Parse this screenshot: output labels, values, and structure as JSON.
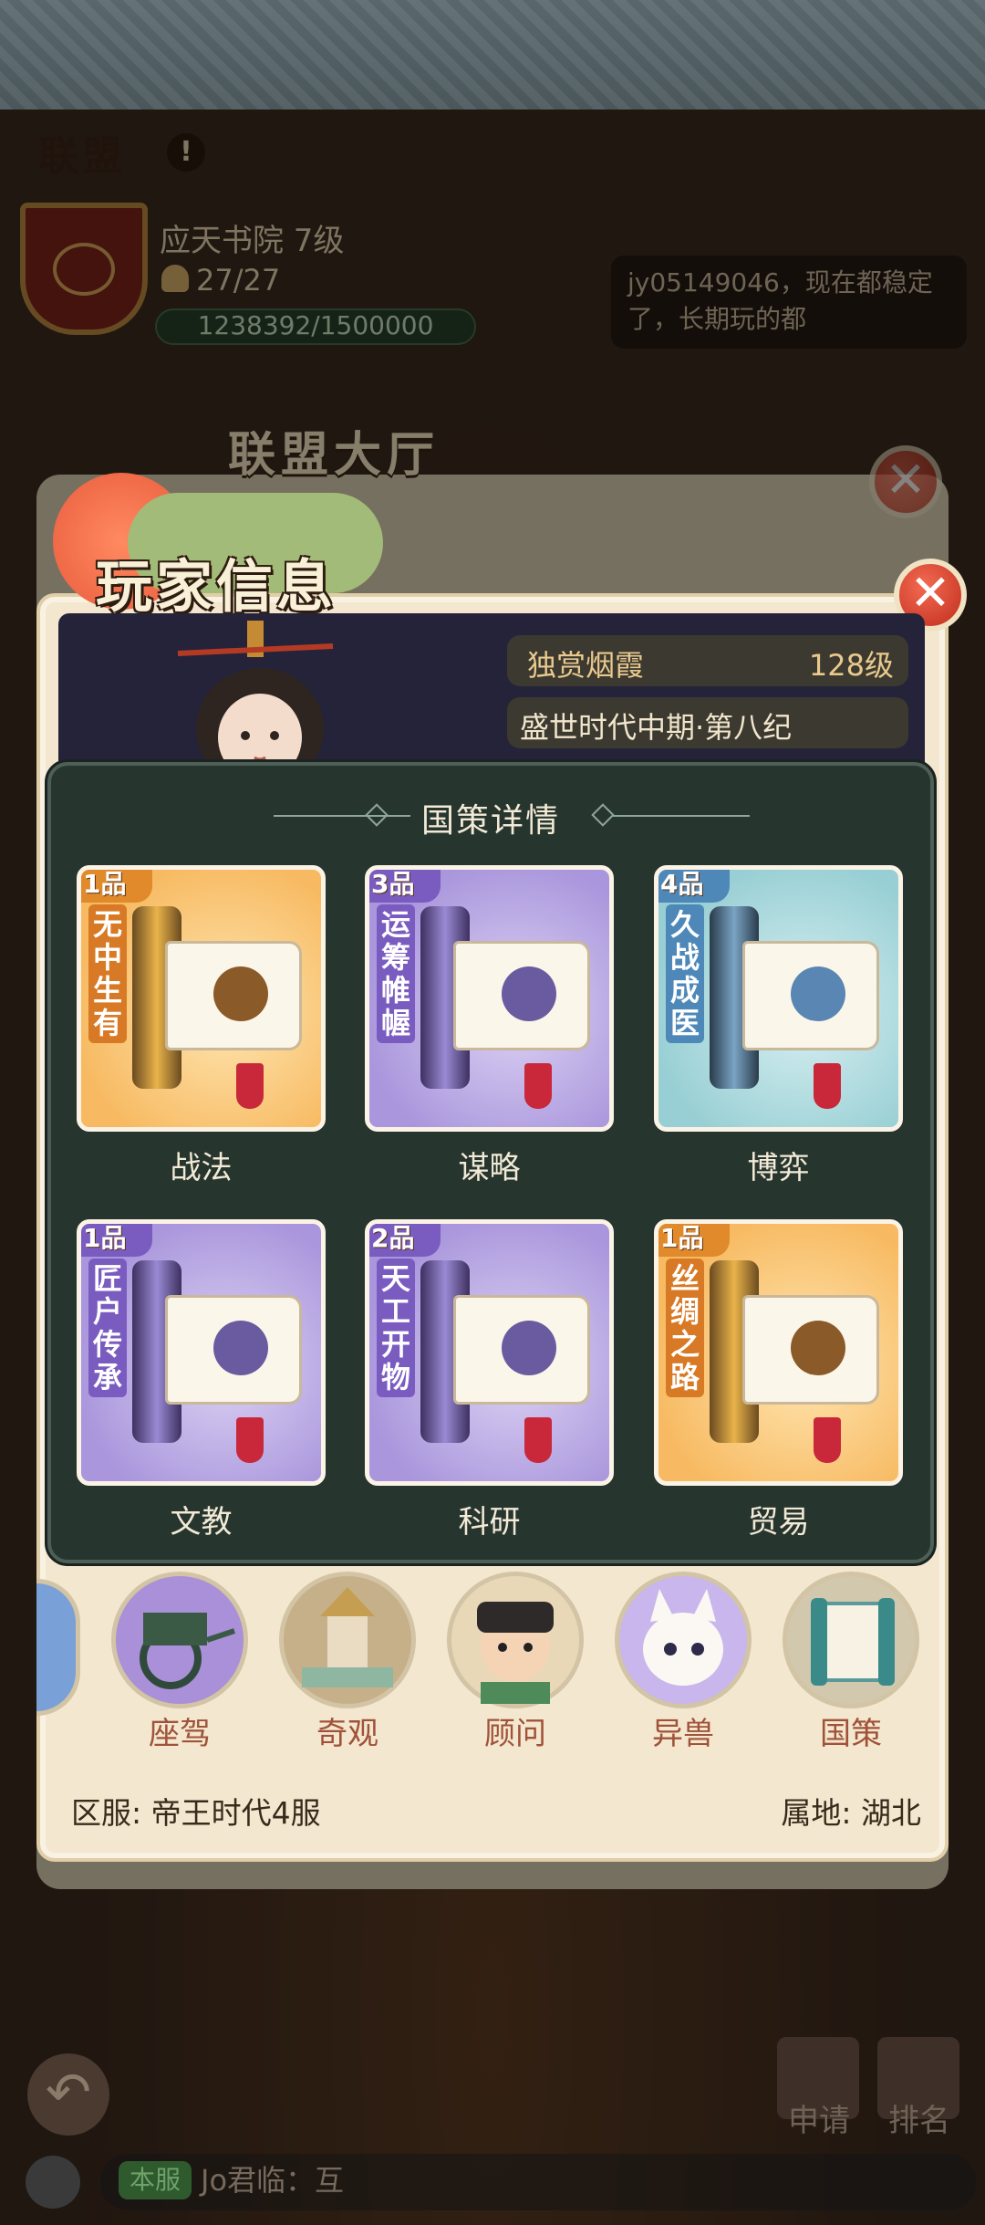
{
  "alliance": {
    "title": "联盟",
    "help_icon": "!",
    "guild_name": "应天书院 7级",
    "members": "27/27",
    "exp": "1238392/1500000",
    "chat_preview": "jy05149046，现在都稳定了，长期玩的都"
  },
  "hall": {
    "title": "联盟大厅",
    "close_icon": "✕"
  },
  "player_info": {
    "title": "玩家信息",
    "close_icon": "✕",
    "name": "独赏烟霞",
    "level": "128级",
    "era": "盛世时代中期·第八纪",
    "server_label": "区服: 帝王时代4服",
    "region_label": "属地: 湖北"
  },
  "policy_popup": {
    "title": "国策详情",
    "cards": [
      {
        "grade": "1品",
        "name": "无中生有",
        "label": "战法",
        "rarity": "gold"
      },
      {
        "grade": "3品",
        "name": "运筹帷幄",
        "label": "谋略",
        "rarity": "purple"
      },
      {
        "grade": "4品",
        "name": "久战成医",
        "label": "博弈",
        "rarity": "blue"
      },
      {
        "grade": "1品",
        "name": "匠户传承",
        "label": "文教",
        "rarity": "purple"
      },
      {
        "grade": "2品",
        "name": "天工开物",
        "label": "科研",
        "rarity": "purple"
      },
      {
        "grade": "1品",
        "name": "丝绸之路",
        "label": "贸易",
        "rarity": "gold"
      }
    ]
  },
  "categories": [
    {
      "label": "座驾",
      "icon": "carriage-icon",
      "color": "#a990d8"
    },
    {
      "label": "奇观",
      "icon": "wonder-tower-icon",
      "color": "#c6b08a"
    },
    {
      "label": "顾问",
      "icon": "advisor-portrait-icon",
      "color": "#e8d8b8"
    },
    {
      "label": "异兽",
      "icon": "beast-icon",
      "color": "#c9b6ec"
    },
    {
      "label": "国策",
      "icon": "policy-scroll-icon",
      "color": "#d2c8ae"
    }
  ],
  "bottom": {
    "back_icon": "↶",
    "apply_label": "申请",
    "rank_label": "排名",
    "chat_tag": "本服",
    "chat_message": "Jo君临：互"
  },
  "colors": {
    "accent_red": "#c02e1c",
    "popup_bg": "#27352f",
    "panel_bg": "#f3e8cf",
    "label_brown": "#a0523a"
  }
}
